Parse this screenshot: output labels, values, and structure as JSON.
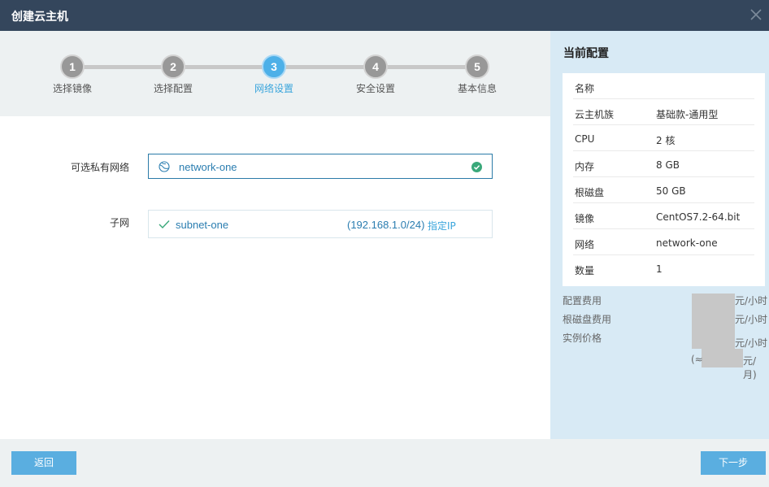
{
  "window": {
    "title": "创建云主机"
  },
  "steps": [
    {
      "number": "1",
      "label": "选择镜像"
    },
    {
      "number": "2",
      "label": "选择配置"
    },
    {
      "number": "3",
      "label": "网络设置"
    },
    {
      "number": "4",
      "label": "安全设置"
    },
    {
      "number": "5",
      "label": "基本信息"
    }
  ],
  "active_step": 3,
  "form": {
    "network_label": "可选私有网络",
    "network_value": "network-one",
    "subnet_label": "子网",
    "subnet_name": "subnet-one",
    "subnet_cidr": "(192.168.1.0/24)",
    "assign_ip": "指定IP"
  },
  "summary": {
    "title": "当前配置",
    "rows": [
      {
        "key": "名称",
        "value": ""
      },
      {
        "key": "云主机族",
        "value": "基础款-通用型"
      },
      {
        "key": "CPU",
        "value": "2 核"
      },
      {
        "key": "内存",
        "value": "8 GB"
      },
      {
        "key": "根磁盘",
        "value": "50 GB"
      },
      {
        "key": "镜像",
        "value": "CentOS7.2-64.bit"
      },
      {
        "key": "网络",
        "value": "network-one"
      },
      {
        "key": "数量",
        "value": "1"
      }
    ],
    "fees": {
      "config_fee_label": "配置费用",
      "disk_fee_label": "根磁盘费用",
      "instance_price_label": "实例价格",
      "per_hour": "元/小时",
      "approx_prefix": "(≈",
      "per_month": "元/月)"
    }
  },
  "footer": {
    "back_label": "返回",
    "next_label": "下一步"
  },
  "colors": {
    "titlebar": "#34465c",
    "accent": "#4db0e8",
    "link": "#2a7db0",
    "panel": "#d8eaf5",
    "button": "#5aaee0"
  }
}
